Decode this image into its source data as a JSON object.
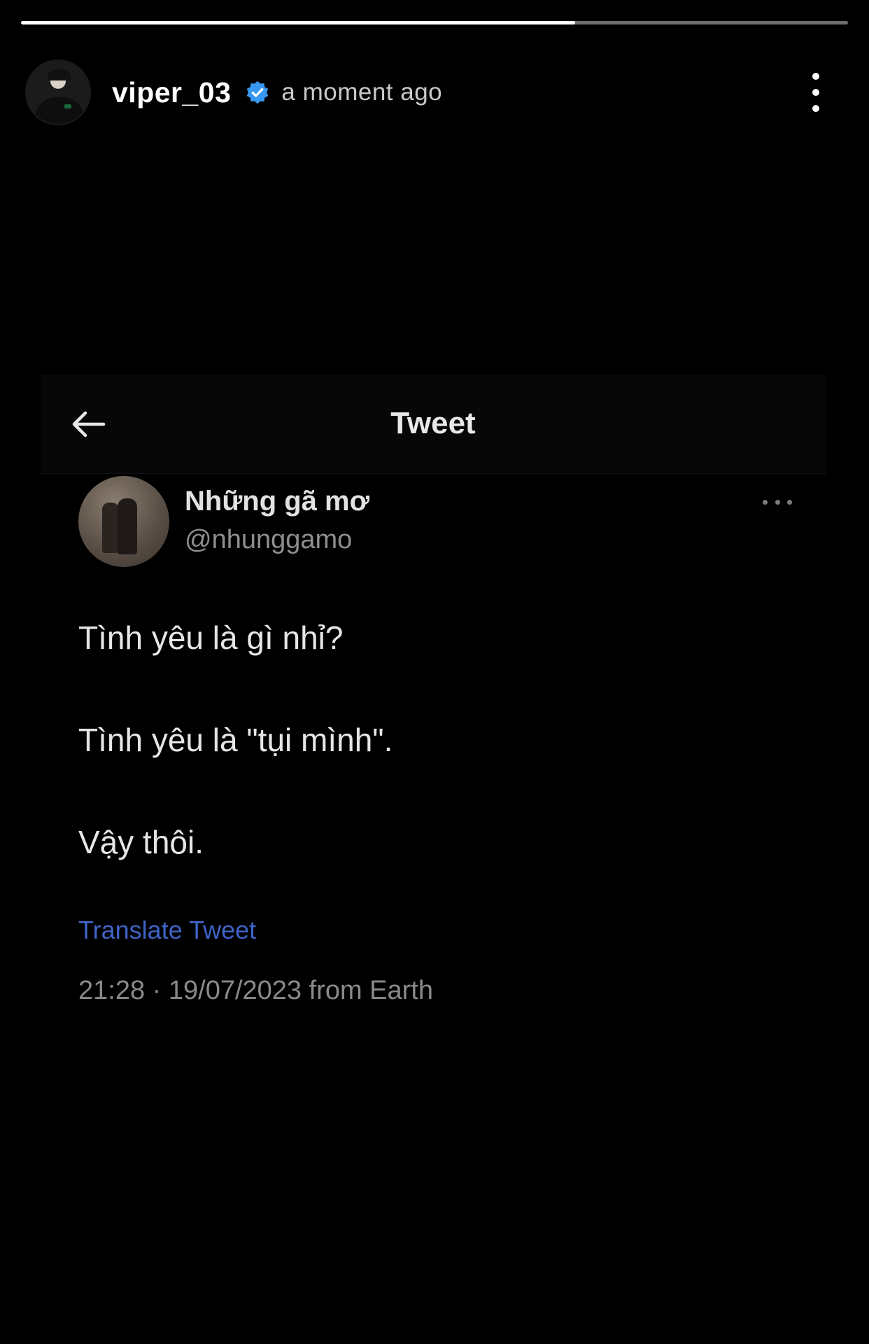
{
  "story": {
    "progress": 0.67,
    "username": "viper_03",
    "verified": true,
    "time": "a moment ago"
  },
  "icons": {
    "verified": "verified-badge-icon",
    "more": "more-vertical-icon",
    "back": "arrow-left-icon",
    "tweet_more": "more-horizontal-icon"
  },
  "colors": {
    "background": "#000000",
    "verified_badge": "#3897f0",
    "link": "#3f63c6"
  },
  "tweet": {
    "header_title": "Tweet",
    "author_name": "Những gã mơ",
    "author_handle": "@nhunggamo",
    "lines": [
      "Tình yêu là gì nhỉ?",
      "Tình yêu là \"tụi mình\".",
      "Vậy thôi."
    ],
    "translate_label": "Translate Tweet",
    "meta": "21:28 · 19/07/2023 from Earth"
  }
}
